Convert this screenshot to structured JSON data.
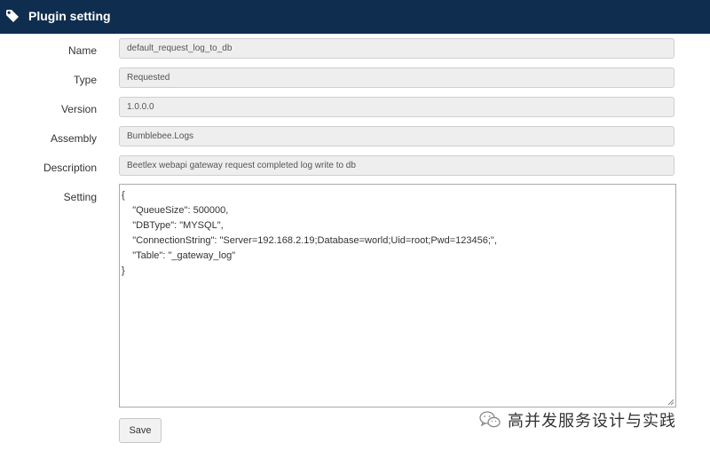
{
  "header": {
    "title": "Plugin setting",
    "icon": "tag-icon"
  },
  "form": {
    "name": {
      "label": "Name",
      "value": "default_request_log_to_db"
    },
    "type": {
      "label": "Type",
      "value": "Requested"
    },
    "version": {
      "label": "Version",
      "value": "1.0.0.0"
    },
    "assembly": {
      "label": "Assembly",
      "value": "Bumblebee.Logs"
    },
    "description": {
      "label": "Description",
      "value": "Beetlex webapi gateway request completed log write to db"
    },
    "setting": {
      "label": "Setting",
      "lines": [
        "{",
        "    \"QueueSize\": 500000,",
        "    \"DBType\": \"MYSQL\",",
        "    \"ConnectionString\": \"Server=192.168.2.19;Database=world;Uid=root;Pwd=123456;\",",
        "    \"Table\": \"_gateway_log\"",
        "}"
      ]
    },
    "save_label": "Save"
  },
  "watermark": {
    "text": "高并发服务设计与实践",
    "icon": "wechat-icon"
  }
}
